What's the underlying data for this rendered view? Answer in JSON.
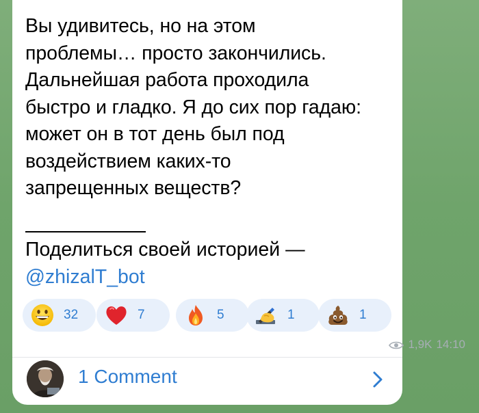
{
  "message": {
    "lines": [
      "Вы удивитесь, но на этом",
      "проблемы… просто закончились.",
      "Дальнейшая работа проходила",
      "быстро и гладко. Я до сих пор гадаю:",
      "может он в тот день был под",
      "воздействием каких-то",
      "запрещенных веществ?"
    ],
    "separator": "___________",
    "share_text": "Поделиться своей историей —",
    "bot_link": "@zhizalT_bot"
  },
  "reactions": [
    {
      "icon": "grinning-face-icon",
      "count": "32"
    },
    {
      "icon": "red-heart-icon",
      "count": "7"
    },
    {
      "icon": "fire-icon",
      "count": "5"
    },
    {
      "icon": "writing-hand-icon",
      "count": "1"
    },
    {
      "icon": "pile-of-poo-icon",
      "count": "1"
    }
  ],
  "meta": {
    "views": "1,9K",
    "time": "14:10",
    "views_icon": "eye-icon"
  },
  "comments": {
    "label": "1 Comment",
    "chevron_icon": "chevron-right-icon"
  },
  "colors": {
    "link": "#2f7dd1",
    "reaction_bg": "#e8f0fb",
    "meta": "#a7aeb5",
    "background": "#7fae7a"
  }
}
